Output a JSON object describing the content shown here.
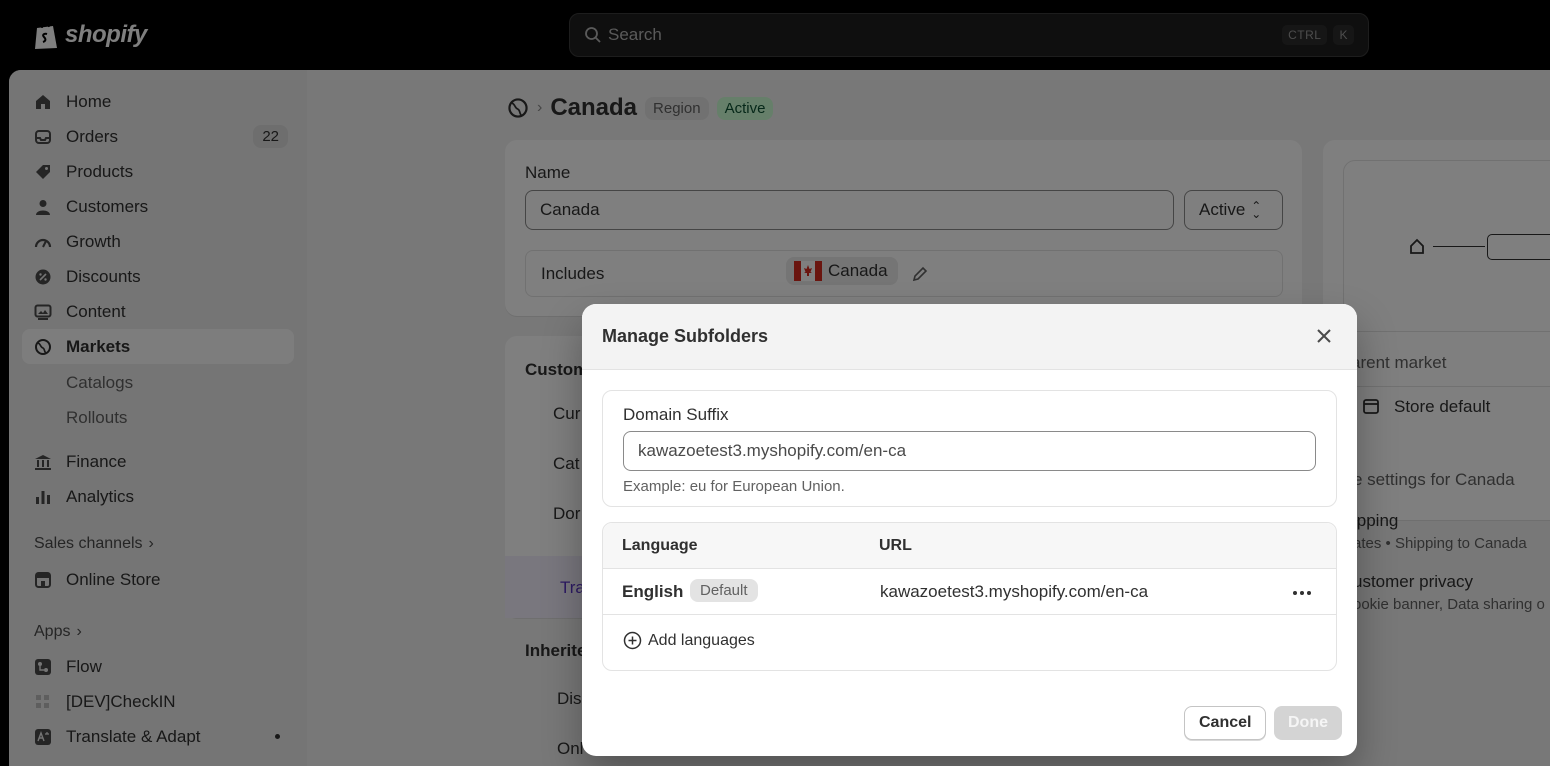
{
  "topbar": {
    "logo_text": "shopify",
    "search_placeholder": "Search",
    "shortcut_keys": [
      "CTRL",
      "K"
    ]
  },
  "sidebar": {
    "items": [
      {
        "label": "Home",
        "icon": "home-icon"
      },
      {
        "label": "Orders",
        "icon": "inbox-icon",
        "badge": "22"
      },
      {
        "label": "Products",
        "icon": "tag-icon"
      },
      {
        "label": "Customers",
        "icon": "person-icon"
      },
      {
        "label": "Growth",
        "icon": "gauge-icon"
      },
      {
        "label": "Discounts",
        "icon": "discount-icon"
      },
      {
        "label": "Content",
        "icon": "image-icon"
      },
      {
        "label": "Markets",
        "icon": "globe-icon",
        "active": true
      }
    ],
    "sub_items": [
      "Catalogs",
      "Rollouts"
    ],
    "items2": [
      {
        "label": "Finance",
        "icon": "bank-icon"
      },
      {
        "label": "Analytics",
        "icon": "bar-chart-icon"
      }
    ],
    "sales_channels_label": "Sales channels",
    "online_store_label": "Online Store",
    "apps_label": "Apps",
    "apps": [
      {
        "label": "Flow"
      },
      {
        "label": "[DEV]CheckIN"
      },
      {
        "label": "Translate & Adapt"
      }
    ]
  },
  "page": {
    "title": "Canada",
    "tag_region": "Region",
    "tag_status": "Active",
    "name_label": "Name",
    "name_value": "Canada",
    "status_select": "Active",
    "includes_label": "Includes",
    "includes_country": "Canada",
    "customize_label": "Custom",
    "rows_partial": [
      "Cur",
      "Cat",
      "Dor"
    ],
    "translate_partial": "Tra",
    "inherited_label": "Inherite",
    "inherited_rows": [
      "Dis",
      "Onl"
    ],
    "right": {
      "parent_market": "arent market",
      "store_default": "Store default",
      "settings_for": "e settings for Canada",
      "shipping_title": "ipping",
      "shipping_sub": "ates • Shipping to Canada",
      "privacy_title": "ustomer privacy",
      "privacy_sub": "ookie banner, Data sharing o"
    }
  },
  "modal": {
    "title": "Manage Subfolders",
    "domain_label": "Domain Suffix",
    "domain_value": "kawazoetest3.myshopify.com/en-ca",
    "domain_help": "Example: eu for European Union.",
    "table_headers": {
      "language": "Language",
      "url": "URL"
    },
    "rows": [
      {
        "language": "English",
        "badge": "Default",
        "url": "kawazoetest3.myshopify.com/en-ca"
      }
    ],
    "add_languages": "Add languages",
    "cancel_label": "Cancel",
    "done_label": "Done"
  }
}
